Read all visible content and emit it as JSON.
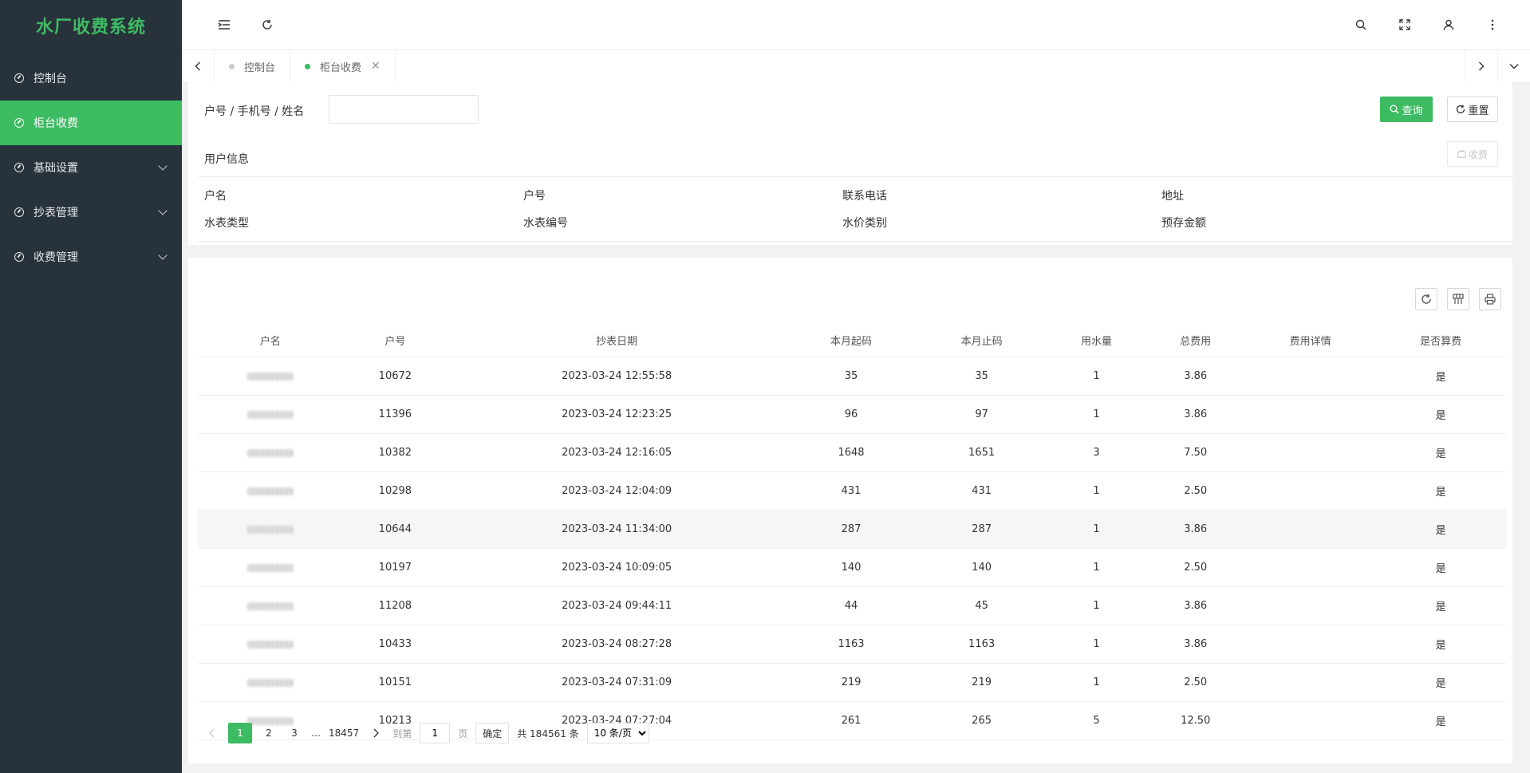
{
  "app": {
    "title": "水厂收费系统"
  },
  "sidebar": {
    "items": [
      {
        "label": "控制台",
        "active": false,
        "expandable": false
      },
      {
        "label": "柜台收费",
        "active": true,
        "expandable": false
      },
      {
        "label": "基础设置",
        "active": false,
        "expandable": true
      },
      {
        "label": "抄表管理",
        "active": false,
        "expandable": true
      },
      {
        "label": "收费管理",
        "active": false,
        "expandable": true
      }
    ]
  },
  "tabs": [
    {
      "label": "控制台",
      "active": false
    },
    {
      "label": "柜台收费",
      "active": true,
      "closable": true
    }
  ],
  "search": {
    "label": "户号 / 手机号 / 姓名",
    "value": "",
    "placeholder": "",
    "query_label": "查询",
    "reset_label": "重置"
  },
  "info": {
    "title": "用户信息",
    "pay_label": "收费",
    "fields": [
      "户名",
      "户号",
      "联系电话",
      "地址",
      "水表类型",
      "水表编号",
      "水价类别",
      "预存金额"
    ]
  },
  "table": {
    "columns": [
      "户名",
      "户号",
      "抄表日期",
      "本月起码",
      "本月止码",
      "用水量",
      "总费用",
      "费用详情",
      "是否算费"
    ],
    "rows": [
      [
        "",
        "10672",
        "2023-03-24 12:55:58",
        "35",
        "35",
        "1",
        "3.86",
        "",
        "是"
      ],
      [
        "",
        "11396",
        "2023-03-24 12:23:25",
        "96",
        "97",
        "1",
        "3.86",
        "",
        "是"
      ],
      [
        "",
        "10382",
        "2023-03-24 12:16:05",
        "1648",
        "1651",
        "3",
        "7.50",
        "",
        "是"
      ],
      [
        "",
        "10298",
        "2023-03-24 12:04:09",
        "431",
        "431",
        "1",
        "2.50",
        "",
        "是"
      ],
      [
        "",
        "10644",
        "2023-03-24 11:34:00",
        "287",
        "287",
        "1",
        "3.86",
        "",
        "是"
      ],
      [
        "",
        "10197",
        "2023-03-24 10:09:05",
        "140",
        "140",
        "1",
        "2.50",
        "",
        "是"
      ],
      [
        "",
        "11208",
        "2023-03-24 09:44:11",
        "44",
        "45",
        "1",
        "3.86",
        "",
        "是"
      ],
      [
        "",
        "10433",
        "2023-03-24 08:27:28",
        "1163",
        "1163",
        "1",
        "3.86",
        "",
        "是"
      ],
      [
        "",
        "10151",
        "2023-03-24 07:31:09",
        "219",
        "219",
        "1",
        "2.50",
        "",
        "是"
      ],
      [
        "",
        "10213",
        "2023-03-24 07:27:04",
        "261",
        "265",
        "5",
        "12.50",
        "",
        "是"
      ]
    ]
  },
  "pager": {
    "pages": [
      "1",
      "2",
      "3"
    ],
    "ellipsis": "…",
    "last_page": "18457",
    "goto_label": "到第",
    "goto_value": "1",
    "page_unit": "页",
    "confirm_label": "确定",
    "total_text": "共 184561 条",
    "page_size": "10 条/页"
  },
  "colors": {
    "accent": "#3dbb63",
    "sidebar_bg": "#28323b"
  }
}
